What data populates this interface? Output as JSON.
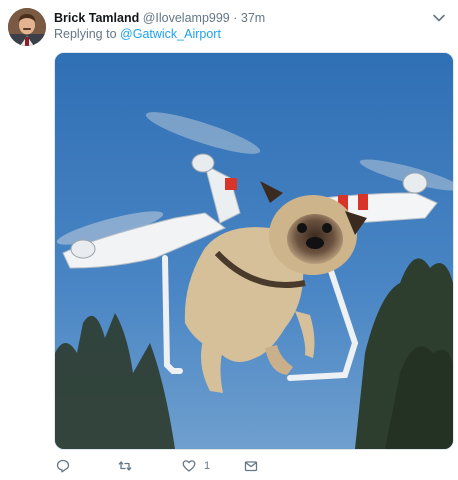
{
  "tweet": {
    "author_name": "Brick Tamland",
    "handle": "@Ilovelamp999",
    "separator": "·",
    "time": "37m",
    "replying_prefix": "Replying to",
    "replying_to": "@Gatwick_Airport",
    "avatar_icon": "user-avatar",
    "menu_icon": "chevron-down-icon",
    "media_description": "pug-dog-hanging-from-quadcopter-drone-photo"
  },
  "actions": {
    "reply_icon": "reply-icon",
    "retweet_icon": "retweet-icon",
    "like_icon": "heart-icon",
    "like_count": "1",
    "dm_icon": "envelope-icon"
  },
  "colors": {
    "link": "#1da1f2",
    "muted": "#657786",
    "text": "#14171a",
    "sky": "#3c78b8"
  }
}
